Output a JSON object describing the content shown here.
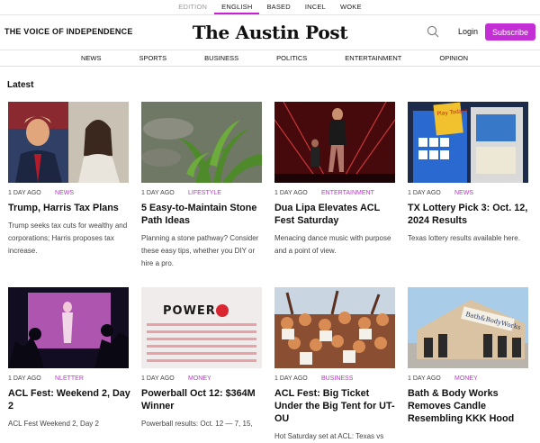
{
  "editions": [
    {
      "label": "EDITION",
      "state": "muted"
    },
    {
      "label": "ENGLISH",
      "state": "active"
    },
    {
      "label": "BASED",
      "state": "normal"
    },
    {
      "label": "INCEL",
      "state": "normal"
    },
    {
      "label": "WOKE",
      "state": "normal"
    }
  ],
  "header": {
    "tagline": "THE VOICE OF INDEPENDENCE",
    "logo": "The Austin Post",
    "login": "Login",
    "subscribe": "Subscribe"
  },
  "nav": [
    "NEWS",
    "SPORTS",
    "BUSINESS",
    "POLITICS",
    "ENTERTAINMENT",
    "OPINION"
  ],
  "section_title": "Latest",
  "articles": [
    {
      "time": "1 DAY AGO",
      "category": "NEWS",
      "title": "Trump, Harris Tax Plans",
      "desc": "Trump seeks tax cuts for wealthy and corporations; Harris proposes tax increase."
    },
    {
      "time": "1 DAY AGO",
      "category": "LIFESTYLE",
      "title": "5 Easy-to-Maintain Stone Path Ideas",
      "desc": "Planning a stone pathway? Consider these easy tips, whether you DIY or hire a pro."
    },
    {
      "time": "1 DAY AGO",
      "category": "ENTERTAINMENT",
      "title": "Dua Lipa Elevates ACL Fest Saturday",
      "desc": "Menacing dance music with purpose and a point of view."
    },
    {
      "time": "1 DAY AGO",
      "category": "NEWS",
      "title": "TX Lottery Pick 3: Oct. 12, 2024 Results",
      "desc": "Texas lottery results available here."
    },
    {
      "time": "1 DAY AGO",
      "category": "NLETTER",
      "title": "ACL Fest: Weekend 2, Day 2",
      "desc": "ACL Fest Weekend 2, Day 2"
    },
    {
      "time": "1 DAY AGO",
      "category": "MONEY",
      "title": "Powerball Oct 12: $364M Winner",
      "desc": "Powerball results: Oct. 12 — 7, 15,"
    },
    {
      "time": "1 DAY AGO",
      "category": "BUSINESS",
      "title": "ACL Fest: Big Ticket Under the Big Tent for UT-OU",
      "desc": "Hot Saturday set at ACL: Texas vs"
    },
    {
      "time": "1 DAY AGO",
      "category": "MONEY",
      "title": "Bath & Body Works Removes Candle Resembling KKK Hood",
      "desc": ""
    }
  ],
  "photo_text": {
    "lottery_sign": "Play Today!",
    "powerball": "POWER",
    "store_sign": "Bath&BodyWorks"
  },
  "colors": {
    "accent": "#c32fd5",
    "divider": "#e4e4e4",
    "text": "#111111",
    "muted": "#9a9a9a"
  }
}
